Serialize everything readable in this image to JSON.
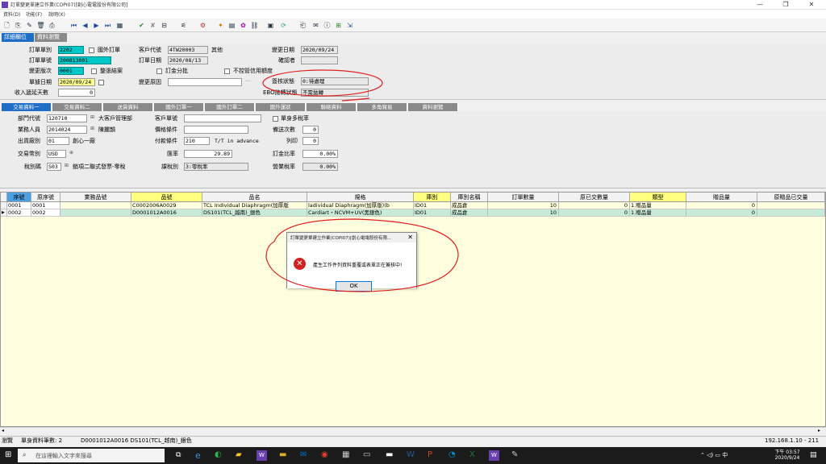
{
  "window": {
    "title": "訂單變更單建立作業(COPI07)[創心電電股份有限公司]"
  },
  "menu": [
    "資料(D)",
    "功能(F)",
    "說明(X)"
  ],
  "toolbar_icons": [
    "new-icon",
    "copy-icon",
    "delete-icon",
    "print-icon",
    "first-icon",
    "prev-icon",
    "next-icon",
    "last-icon",
    "query-icon",
    "confirm-icon",
    "cancel-icon",
    "save-icon",
    "edit-icon",
    "filter-icon",
    "settings-icon",
    "help-icon",
    "attach-icon",
    "exit-icon"
  ],
  "top_tabs": [
    "詳細欄位",
    "資料瀏覽"
  ],
  "header": {
    "order_type_label": "訂單單別",
    "order_type": "2202",
    "foreign_order": "國外訂單",
    "order_no_label": "訂單單號",
    "order_no": "200813001",
    "change_ver_label": "變更版次",
    "change_ver": "0001",
    "close_label": "整張結案",
    "doc_date_label": "單據日期",
    "doc_date": "2020/09/24",
    "recv_days_label": "收入遞延天數",
    "recv_days": "0",
    "cust_code_label": "客戶代號",
    "cust_code": "4TW20003",
    "cust_other": "其他",
    "order_date_label": "訂單日期",
    "order_date": "2020/08/13",
    "deposit_label": "訂金分批",
    "credit_label": "不控管信用額度",
    "change_reason_label": "變更原因",
    "change_date_label": "變更日期",
    "change_date": "2020/09/24",
    "confirmer_label": "確認者",
    "approval_label": "簽核狀態",
    "approval": "0:待處理",
    "ebo_label": "EBO拋轉狀態",
    "ebo": "不需拋轉"
  },
  "tabs2": [
    "交易資料一",
    "交易資料二",
    "送貨資料",
    "國外訂單一",
    "國外訂單二",
    "國外運狀",
    "聯絡資料",
    "多角貿易",
    "資料瀏覽"
  ],
  "body2": {
    "dept_label": "部門代號",
    "dept": "120710",
    "dept_name": "大客戶管理部",
    "sales_label": "業務人員",
    "sales": "2014024",
    "sales_name": "陳麗韻",
    "ship_label": "出貨廠別",
    "ship": "01",
    "ship_name": "創心一廠",
    "currency_label": "交易幣別",
    "currency": "USD",
    "tax_label": "稅別碼",
    "tax": "S03",
    "tax_name": "銷項二聯式發票-零稅",
    "cust_no_label": "客戶單號",
    "multi_tax": "單身多稅率",
    "price_label": "價格條件",
    "print_label": "備送次數",
    "print": "0",
    "pay_label": "付款條件",
    "pay": "210",
    "pay_name": "T/T in advance",
    "col_label": "列印",
    "col": "0",
    "rate_label": "匯率",
    "rate": "29.89",
    "deposit_rate_label": "訂金比率",
    "deposit_rate": "0.00%",
    "tax_type_label": "課稅別",
    "tax_type": "3:零稅率",
    "biz_tax_label": "營業稅率",
    "biz_tax": "0.00%"
  },
  "grid": {
    "headers": [
      "序號",
      "原序號",
      "業務品號",
      "品號",
      "品名",
      "規格",
      "庫別",
      "庫別名稱",
      "訂單數量",
      "原已交數量",
      "類型",
      "贈品量",
      "原贈品已交量"
    ],
    "rows": [
      [
        "0001",
        "0001",
        "",
        "C0002006A0029",
        "TCL Individual Diaphragm(加厚版",
        "ladividual Diaphragm(加厚版)(b",
        "ID01",
        "成品倉",
        "10",
        "0",
        "1.贈品量",
        "0",
        ""
      ],
      [
        "0002",
        "0002",
        "",
        "D0001012A0016",
        "DS101(TCL_越南)_銀色",
        "Cardiart・NCVM+UV(黑銀色)",
        "ID01",
        "成品倉",
        "10",
        "0",
        "1.贈品量",
        "0",
        ""
      ]
    ]
  },
  "dialog": {
    "title": "訂單變更單建立作業(COPI07)[創心電電股份有限...",
    "message": "產生工作件列資料重覆或表單正在簽核中!",
    "ok": "OK",
    "close": "✕"
  },
  "status": {
    "mode": "瀏覽",
    "count": "單身資料筆數: 2",
    "item": "D0001012A0016 DS101(TCL_越南)_銀色",
    "ip": "192.168.1.10 - 211"
  },
  "taskbar": {
    "search": "在這裡輸入文字來搜尋",
    "time": "下午 03:57",
    "date": "2020/9/24"
  }
}
